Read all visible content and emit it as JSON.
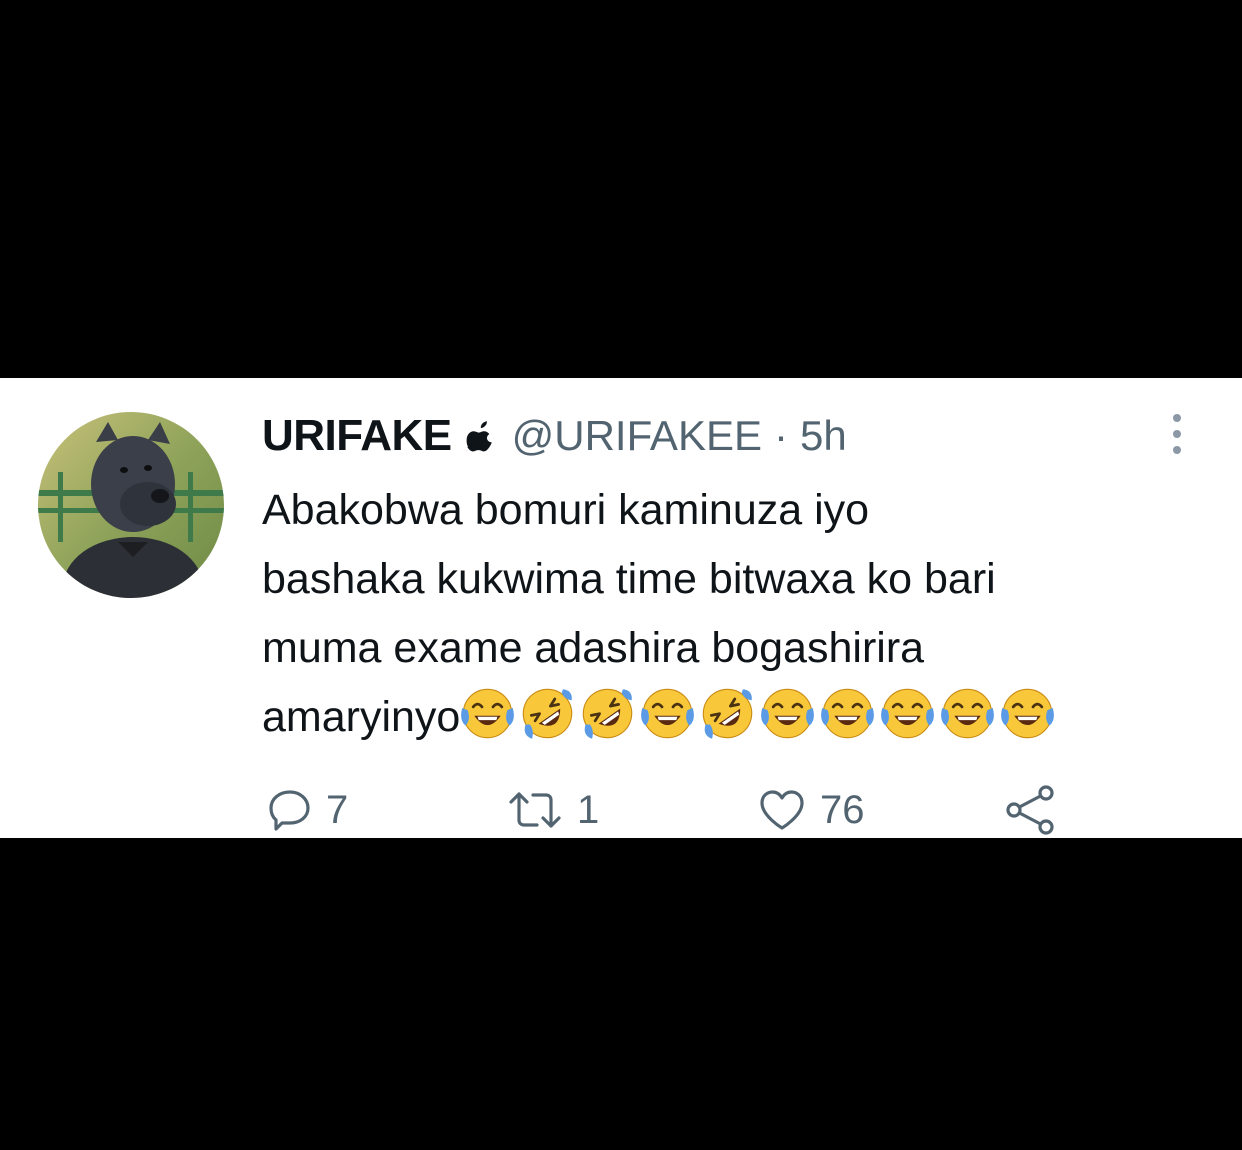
{
  "tweet": {
    "display_name": "URIFAKE",
    "badge_icon": "apple-icon",
    "handle": "@URIFAKEE",
    "separator": "·",
    "time": "5h",
    "text_lines": [
      "Abakobwa bomuri kaminuza iyo",
      "bashaka kukwima time bitwaxa ko bari",
      "muma exame adashira bogashirira",
      "amaryinyo"
    ],
    "emojis": [
      "😂",
      "🤣",
      "🤣",
      "😂",
      "🤣",
      "😂",
      "😂",
      "😂",
      "😂",
      "😂"
    ],
    "avatar_icon": "dog-avatar",
    "more_icon": "vertical-ellipsis-icon"
  },
  "actions": {
    "replies": "7",
    "retweets": "1",
    "likes": "76"
  },
  "colors": {
    "background": "#000000",
    "card": "#ffffff",
    "text_primary": "#0f1419",
    "text_secondary": "#536471",
    "emoji_yellow": "#f8c83a",
    "tear_blue": "#5b9be6"
  }
}
